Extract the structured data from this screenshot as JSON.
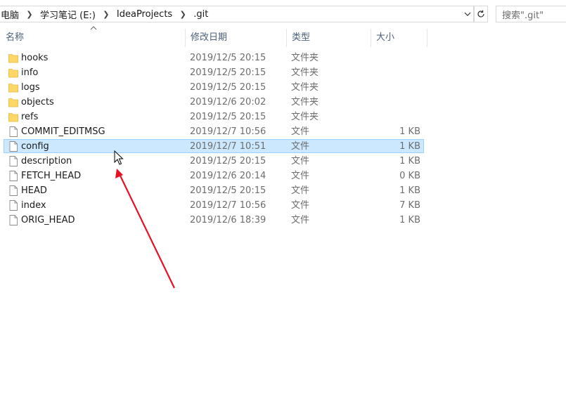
{
  "address_bar": {
    "crumbs": [
      "电脑",
      "学习笔记 (E:)",
      "IdeaProjects",
      ".git"
    ]
  },
  "search": {
    "placeholder": "搜索\".git\""
  },
  "columns": {
    "name": "名称",
    "date": "修改日期",
    "type": "类型",
    "size": "大小"
  },
  "files": [
    {
      "name": "hooks",
      "date": "2019/12/5 20:15",
      "type": "文件夹",
      "size": "",
      "icon": "folder-icon"
    },
    {
      "name": "info",
      "date": "2019/12/5 20:15",
      "type": "文件夹",
      "size": "",
      "icon": "folder-icon"
    },
    {
      "name": "logs",
      "date": "2019/12/5 20:15",
      "type": "文件夹",
      "size": "",
      "icon": "folder-icon"
    },
    {
      "name": "objects",
      "date": "2019/12/6 20:02",
      "type": "文件夹",
      "size": "",
      "icon": "folder-icon"
    },
    {
      "name": "refs",
      "date": "2019/12/5 20:15",
      "type": "文件夹",
      "size": "",
      "icon": "folder-icon"
    },
    {
      "name": "COMMIT_EDITMSG",
      "date": "2019/12/7 10:56",
      "type": "文件",
      "size": "1 KB",
      "icon": "file-icon"
    },
    {
      "name": "config",
      "date": "2019/12/7 10:51",
      "type": "文件",
      "size": "1 KB",
      "icon": "file-icon",
      "selected": true
    },
    {
      "name": "description",
      "date": "2019/12/5 20:15",
      "type": "文件",
      "size": "1 KB",
      "icon": "file-icon"
    },
    {
      "name": "FETCH_HEAD",
      "date": "2019/12/6 20:14",
      "type": "文件",
      "size": "0 KB",
      "icon": "file-icon"
    },
    {
      "name": "HEAD",
      "date": "2019/12/5 20:15",
      "type": "文件",
      "size": "1 KB",
      "icon": "file-icon"
    },
    {
      "name": "index",
      "date": "2019/12/7 10:56",
      "type": "文件",
      "size": "7 KB",
      "icon": "file-icon"
    },
    {
      "name": "ORIG_HEAD",
      "date": "2019/12/6 18:39",
      "type": "文件",
      "size": "1 KB",
      "icon": "file-icon"
    }
  ],
  "colors": {
    "selection_bg": "#cce8ff",
    "selection_border": "#99d1ff",
    "folder": "#ffd766",
    "annotation_arrow": "#e81123"
  }
}
